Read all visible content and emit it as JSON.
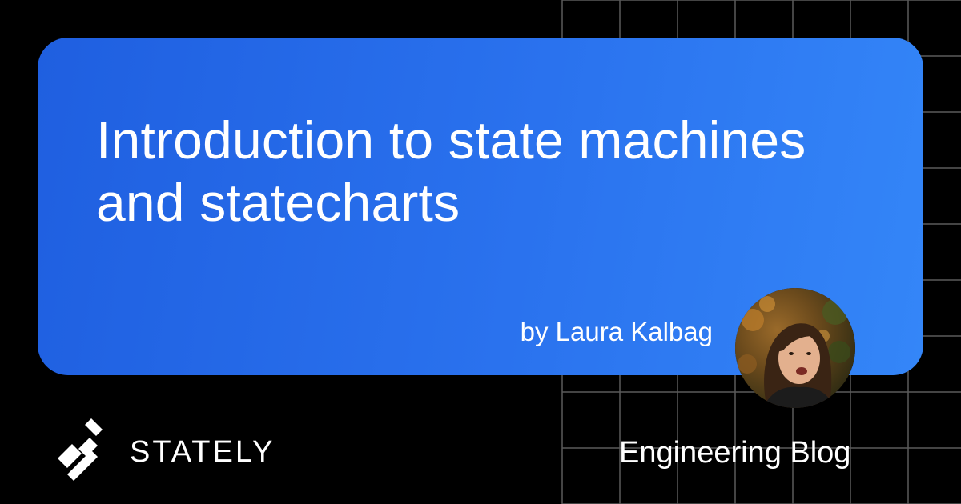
{
  "title": "Introduction to state machines and statecharts",
  "byline": "by Laura Kalbag",
  "brand": {
    "name": "STATELY",
    "icon": "stately-logo-icon"
  },
  "section_label": "Engineering Blog",
  "avatar": {
    "icon": "author-photo"
  },
  "colors": {
    "background": "#000000",
    "card_gradient_start": "#1f5fe0",
    "card_gradient_end": "#3486f8",
    "grid_lines": "#5a5a5a",
    "text": "#ffffff"
  }
}
